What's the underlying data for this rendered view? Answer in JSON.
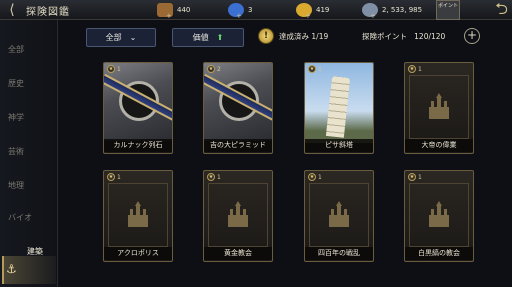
{
  "header": {
    "title": "探険図鑑",
    "resources": [
      {
        "name": "wood",
        "value": "440",
        "color": "#9b6a34"
      },
      {
        "name": "crystal",
        "value": "3",
        "color": "#3b6fd1"
      },
      {
        "name": "gold",
        "value": "419",
        "color": "#d9a930"
      },
      {
        "name": "silver",
        "value": "2, 533, 985",
        "color": "#7f8fa6"
      }
    ],
    "point_tab": "ポイント"
  },
  "sidebar": {
    "items": [
      {
        "label": "全部"
      },
      {
        "label": "歴史"
      },
      {
        "label": "神学"
      },
      {
        "label": "芸術"
      },
      {
        "label": "地理"
      },
      {
        "label": "バイオ"
      },
      {
        "label": "建築",
        "active": true
      }
    ]
  },
  "filters": {
    "category": "全部",
    "category_icon": "chevron-down",
    "sort": "価値",
    "sort_icon": "arrow-up"
  },
  "progress": {
    "achieved_label": "達成済み",
    "achieved_value": "1/19",
    "explore_label": "探険ポイント",
    "explore_value": "120/120"
  },
  "cards": [
    {
      "name": "カルナック列石",
      "stars": "1",
      "art": "emblem"
    },
    {
      "name": "吉の大ピラミッド",
      "stars": "2",
      "art": "emblem"
    },
    {
      "name": "ピサ斜塔",
      "stars": "1",
      "art": "pisa"
    },
    {
      "name": "大帝の偉業",
      "stars": "1",
      "art": "building"
    },
    {
      "name": "アクロポリス",
      "stars": "1",
      "art": "building"
    },
    {
      "name": "黄金教会",
      "stars": "1",
      "art": "building"
    },
    {
      "name": "四百年の戦乱",
      "stars": "1",
      "art": "building"
    },
    {
      "name": "白黒縞の教会",
      "stars": "1",
      "art": "building"
    }
  ]
}
